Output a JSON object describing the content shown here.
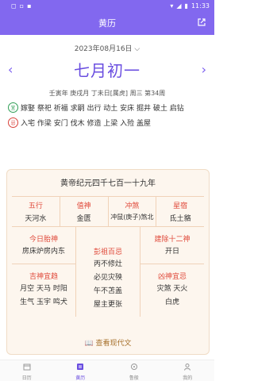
{
  "status_bar": {
    "left_icons": [
      "notification-icon",
      "signal-icon",
      "lock-icon"
    ],
    "time": "11:33"
  },
  "appbar": {
    "title": "黄历"
  },
  "date": {
    "solar": "2023年08月16日"
  },
  "lunar": {
    "title": "七月初一",
    "ganzhi": "壬寅年 庚戌月 丁未日[属虎] 周三 第34周"
  },
  "yi": {
    "badge": "宜",
    "text": "嫁娶 祭祀 祈福 求嗣 出行 动土 安床 掘井 破土 启钻"
  },
  "ji": {
    "badge": "忌",
    "text": "入宅 作梁 安门 伐木 修造 上梁 入殓 盖屋"
  },
  "card": {
    "year": "黄帝纪元四千七百一十九年",
    "row1": [
      {
        "label": "五行",
        "value": "天河水"
      },
      {
        "label": "值神",
        "value": "金匮"
      },
      {
        "label": "冲煞",
        "value": "冲鼠(庚子)煞北"
      },
      {
        "label": "星宿",
        "value": "氐土貉"
      }
    ],
    "taishen": {
      "label": "今日胎神",
      "value": "房床炉房内东"
    },
    "jishen": {
      "label": "吉神宜趋",
      "line1": "月空 天马 时阳",
      "line2": "生气 玉宇 鸣犬"
    },
    "pengzu": {
      "label": "彭祖百忌",
      "line1": "丙不修灶",
      "line2": "必见灾殃",
      "line3": "午不苫盖",
      "line4": "屋主更张"
    },
    "jianchu": {
      "label": "建除十二神",
      "value": "开日"
    },
    "xiongshen": {
      "label": "凶神宜忌",
      "line1": "灾煞 天火",
      "line2": "白虎"
    },
    "view_modern": "查看现代文"
  },
  "tabs": [
    {
      "label": "日历",
      "icon": "calendar-icon"
    },
    {
      "label": "黄历",
      "icon": "almanac-icon"
    },
    {
      "label": "鲁般",
      "icon": "tool-icon"
    },
    {
      "label": "我的",
      "icon": "user-icon"
    }
  ],
  "colors": {
    "primary": "#8268ef",
    "red": "#e04a3b",
    "green": "#2f9e55",
    "card_bg": "#fdf6ee"
  }
}
